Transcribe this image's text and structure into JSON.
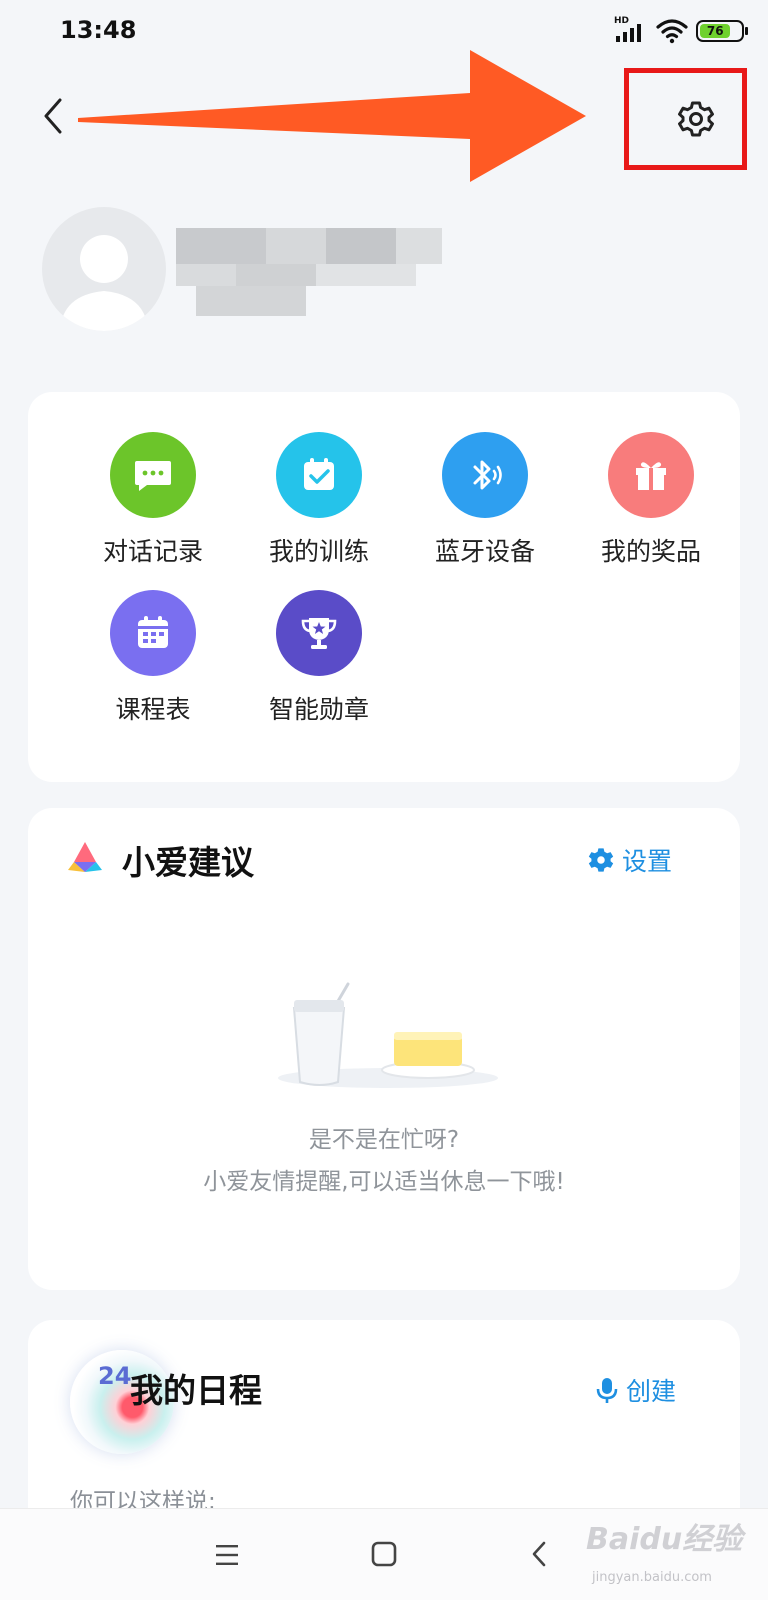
{
  "status_bar": {
    "time": "13:48",
    "signal_label": "HD",
    "battery_level": "76",
    "battery_fill_percent": 76,
    "icons": [
      "signal-icon",
      "wifi-icon",
      "battery-icon"
    ]
  },
  "header": {
    "back_icon": "chevron-left-icon",
    "settings_icon": "gear-icon"
  },
  "profile": {
    "avatar_icon": "default-avatar-icon",
    "name_obscured": true
  },
  "menu": {
    "items": [
      {
        "label": "对话记录",
        "icon": "chat-icon",
        "color": "#6cc52a"
      },
      {
        "label": "我的训练",
        "icon": "calendar-check-icon",
        "color": "#25c3ea"
      },
      {
        "label": "蓝牙设备",
        "icon": "bluetooth-icon",
        "color": "#2e9ff0"
      },
      {
        "label": "我的奖品",
        "icon": "gift-icon",
        "color": "#f87c7c"
      },
      {
        "label": "课程表",
        "icon": "timetable-icon",
        "color": "#7a6ff0"
      },
      {
        "label": "智能勋章",
        "icon": "trophy-icon",
        "color": "#5a4cc8"
      }
    ]
  },
  "suggestions": {
    "title": "小爱建议",
    "action_label": "设置",
    "action_icon": "gear-icon",
    "empty_title": "是不是在忙呀?",
    "empty_subtitle": "小爱友情提醒,可以适当休息一下哦!"
  },
  "schedule": {
    "title": "我的日程",
    "action_label": "创建",
    "action_icon": "microphone-icon",
    "calendar_day": "24",
    "hint": "你可以这样说:"
  },
  "nav_bar": {
    "icons": [
      "menu-icon",
      "home-square-icon",
      "back-triangle-icon"
    ]
  },
  "watermark": {
    "text": "Baidu经验",
    "sub": "jingyan.baidu.com"
  },
  "colors": {
    "accent_blue": "#1e8fe1",
    "annotation_red": "#e81919",
    "annotation_arrow": "#ff5a24",
    "background": "#f4f6f9"
  }
}
